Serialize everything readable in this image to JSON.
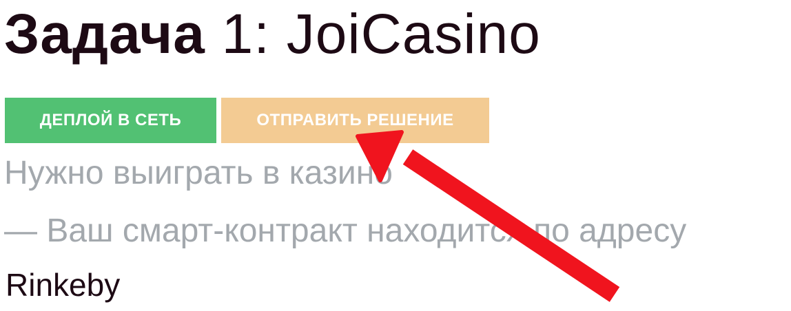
{
  "title": {
    "bold": "Задача",
    "rest": " 1: JoiCasino"
  },
  "buttons": {
    "deploy_label": "ДЕПЛОЙ В СЕТЬ",
    "submit_label": "ОТПРАВИТЬ РЕШЕНИЕ"
  },
  "description": {
    "line1": "Нужно выиграть в казино",
    "line2": "— Ваш смарт-контракт находится по адресу"
  },
  "network": "Rinkeby",
  "colors": {
    "deploy_button": "#52c173",
    "submit_button": "#f3cb93",
    "arrow": "#f0141e",
    "title_text": "#1d0a14",
    "description_text": "#a3a8ad"
  },
  "annotation_icon": "red-arrow-icon"
}
